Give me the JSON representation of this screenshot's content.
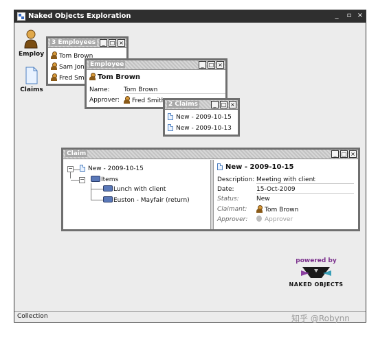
{
  "app": {
    "title": "Naked Objects Exploration",
    "controls": {
      "minimize": "_",
      "maximize": "▫",
      "close": "×"
    },
    "status": "Collection"
  },
  "desktop": {
    "employees_label": "Employ",
    "claims_label": "Claims"
  },
  "employees_window": {
    "title": "3 Employees",
    "items": [
      "Tom Brown",
      "Sam Jon",
      "Fred Smi"
    ]
  },
  "employee_window": {
    "title": "Employee",
    "heading": "Tom Brown",
    "fields": {
      "name_label": "Name:",
      "name_value": "Tom Brown",
      "approver_label": "Approver:",
      "approver_value": "Fred Smith"
    }
  },
  "claims_window": {
    "title": "2 Claims",
    "items": [
      "New - 2009-10-15",
      "New - 2009-10-13"
    ]
  },
  "claim_window": {
    "title": "Claim",
    "tree": {
      "root": "New - 2009-10-15",
      "items_label": "Items",
      "children": [
        "Lunch with client",
        "Euston - Mayfair (return)"
      ]
    },
    "detail": {
      "heading": "New - 2009-10-15",
      "description_label": "Description:",
      "description_value": "Meeting with client",
      "date_label": "Date:",
      "date_value": "15-Oct-2009",
      "status_label": "Status:",
      "status_value": "New",
      "claimant_label": "Claimant:",
      "claimant_value": "Tom Brown",
      "approver_label": "Approver:",
      "approver_value": "Approver"
    }
  },
  "branding": {
    "powered": "powered by",
    "name": "NAKED OBJECTS"
  },
  "watermark": "知乎 @Robynn",
  "colors": {
    "titlebar": "#2f2f2f",
    "desktop": "#ececec",
    "window_border": "#6f6f6f",
    "brand_purple": "#7a2f8c"
  }
}
